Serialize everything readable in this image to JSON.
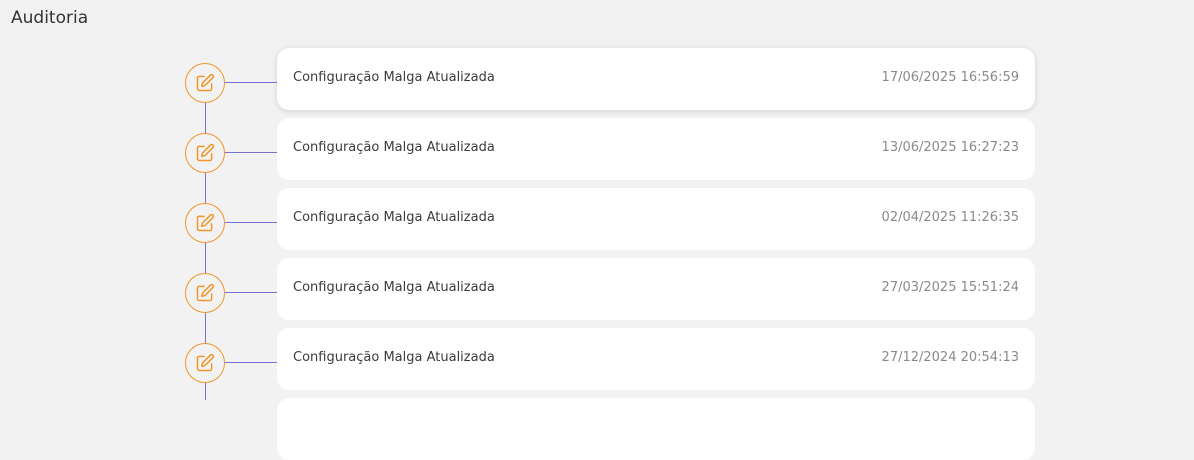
{
  "page": {
    "title": "Auditoria"
  },
  "colors": {
    "icon_accent": "#f0962a",
    "timeline_line": "#7b6fd4",
    "background": "#f2f2f2",
    "card_background": "#ffffff"
  },
  "audit": {
    "items": [
      {
        "icon": "edit-icon",
        "label": "Configuração Malga Atualizada",
        "timestamp": "17/06/2025 16:56:59"
      },
      {
        "icon": "edit-icon",
        "label": "Configuração Malga Atualizada",
        "timestamp": "13/06/2025 16:27:23"
      },
      {
        "icon": "edit-icon",
        "label": "Configuração Malga Atualizada",
        "timestamp": "02/04/2025 11:26:35"
      },
      {
        "icon": "edit-icon",
        "label": "Configuração Malga Atualizada",
        "timestamp": "27/03/2025 15:51:24"
      },
      {
        "icon": "edit-icon",
        "label": "Configuração Malga Atualizada",
        "timestamp": "27/12/2024 20:54:13"
      }
    ]
  }
}
